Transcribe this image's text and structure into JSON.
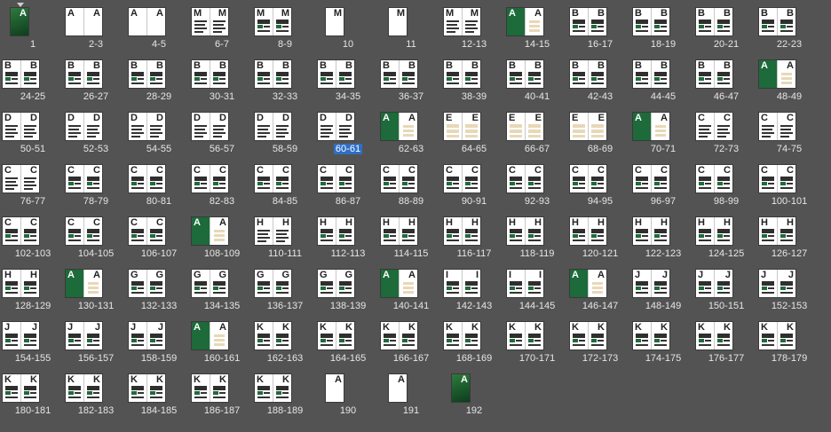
{
  "panel": {
    "title": "",
    "selected": "60-61"
  },
  "spreads": [
    {
      "label": "1",
      "l": "",
      "r": "A",
      "kind": "cover"
    },
    {
      "label": "2-3",
      "l": "A",
      "r": "A",
      "kind": "plain"
    },
    {
      "label": "4-5",
      "l": "A",
      "r": "A",
      "kind": "plain"
    },
    {
      "label": "6-7",
      "l": "M",
      "r": "M",
      "kind": "text"
    },
    {
      "label": "8-9",
      "l": "M",
      "r": "M",
      "kind": "dense"
    },
    {
      "label": "10",
      "l": "",
      "r": "M",
      "kind": "single"
    },
    {
      "label": "11",
      "l": "",
      "r": "M",
      "kind": "single"
    },
    {
      "label": "12-13",
      "l": "M",
      "r": "M",
      "kind": "text"
    },
    {
      "label": "14-15",
      "l": "A",
      "r": "A",
      "kind": "green"
    },
    {
      "label": "16-17",
      "l": "B",
      "r": "B",
      "kind": "dense"
    },
    {
      "label": "18-19",
      "l": "B",
      "r": "B",
      "kind": "dense"
    },
    {
      "label": "20-21",
      "l": "B",
      "r": "B",
      "kind": "dense"
    },
    {
      "label": "22-23",
      "l": "B",
      "r": "B",
      "kind": "dense"
    },
    {
      "label": "24-25",
      "l": "B",
      "r": "B",
      "kind": "dense"
    },
    {
      "label": "26-27",
      "l": "B",
      "r": "B",
      "kind": "dense"
    },
    {
      "label": "28-29",
      "l": "B",
      "r": "B",
      "kind": "dense"
    },
    {
      "label": "30-31",
      "l": "B",
      "r": "B",
      "kind": "dense"
    },
    {
      "label": "32-33",
      "l": "B",
      "r": "B",
      "kind": "dense"
    },
    {
      "label": "34-35",
      "l": "B",
      "r": "B",
      "kind": "dense"
    },
    {
      "label": "36-37",
      "l": "B",
      "r": "B",
      "kind": "dense"
    },
    {
      "label": "38-39",
      "l": "B",
      "r": "B",
      "kind": "dense"
    },
    {
      "label": "40-41",
      "l": "B",
      "r": "B",
      "kind": "dense"
    },
    {
      "label": "42-43",
      "l": "B",
      "r": "B",
      "kind": "dense"
    },
    {
      "label": "44-45",
      "l": "B",
      "r": "B",
      "kind": "dense"
    },
    {
      "label": "46-47",
      "l": "B",
      "r": "B",
      "kind": "dense"
    },
    {
      "label": "48-49",
      "l": "A",
      "r": "A",
      "kind": "green"
    },
    {
      "label": "50-51",
      "l": "D",
      "r": "D",
      "kind": "text"
    },
    {
      "label": "52-53",
      "l": "D",
      "r": "D",
      "kind": "text"
    },
    {
      "label": "54-55",
      "l": "D",
      "r": "D",
      "kind": "text"
    },
    {
      "label": "56-57",
      "l": "D",
      "r": "D",
      "kind": "text"
    },
    {
      "label": "58-59",
      "l": "D",
      "r": "D",
      "kind": "text"
    },
    {
      "label": "60-61",
      "l": "D",
      "r": "D",
      "kind": "text"
    },
    {
      "label": "62-63",
      "l": "A",
      "r": "A",
      "kind": "green"
    },
    {
      "label": "64-65",
      "l": "E",
      "r": "E",
      "kind": "tan"
    },
    {
      "label": "66-67",
      "l": "E",
      "r": "E",
      "kind": "tan"
    },
    {
      "label": "68-69",
      "l": "E",
      "r": "E",
      "kind": "tan"
    },
    {
      "label": "70-71",
      "l": "A",
      "r": "A",
      "kind": "green"
    },
    {
      "label": "72-73",
      "l": "C",
      "r": "C",
      "kind": "text"
    },
    {
      "label": "74-75",
      "l": "C",
      "r": "C",
      "kind": "text"
    },
    {
      "label": "76-77",
      "l": "C",
      "r": "C",
      "kind": "text"
    },
    {
      "label": "78-79",
      "l": "C",
      "r": "C",
      "kind": "dense"
    },
    {
      "label": "80-81",
      "l": "C",
      "r": "C",
      "kind": "dense"
    },
    {
      "label": "82-83",
      "l": "C",
      "r": "C",
      "kind": "dense"
    },
    {
      "label": "84-85",
      "l": "C",
      "r": "C",
      "kind": "dense"
    },
    {
      "label": "86-87",
      "l": "C",
      "r": "C",
      "kind": "dense"
    },
    {
      "label": "88-89",
      "l": "C",
      "r": "C",
      "kind": "dense"
    },
    {
      "label": "90-91",
      "l": "C",
      "r": "C",
      "kind": "dense"
    },
    {
      "label": "92-93",
      "l": "C",
      "r": "C",
      "kind": "dense"
    },
    {
      "label": "94-95",
      "l": "C",
      "r": "C",
      "kind": "dense"
    },
    {
      "label": "96-97",
      "l": "C",
      "r": "C",
      "kind": "dense"
    },
    {
      "label": "98-99",
      "l": "C",
      "r": "C",
      "kind": "dense"
    },
    {
      "label": "100-101",
      "l": "C",
      "r": "C",
      "kind": "dense"
    },
    {
      "label": "102-103",
      "l": "C",
      "r": "C",
      "kind": "dense"
    },
    {
      "label": "104-105",
      "l": "C",
      "r": "C",
      "kind": "dense"
    },
    {
      "label": "106-107",
      "l": "C",
      "r": "C",
      "kind": "dense"
    },
    {
      "label": "108-109",
      "l": "A",
      "r": "A",
      "kind": "green"
    },
    {
      "label": "110-111",
      "l": "H",
      "r": "H",
      "kind": "text"
    },
    {
      "label": "112-113",
      "l": "H",
      "r": "H",
      "kind": "dense"
    },
    {
      "label": "114-115",
      "l": "H",
      "r": "H",
      "kind": "dense"
    },
    {
      "label": "116-117",
      "l": "H",
      "r": "H",
      "kind": "dense"
    },
    {
      "label": "118-119",
      "l": "H",
      "r": "H",
      "kind": "dense"
    },
    {
      "label": "120-121",
      "l": "H",
      "r": "H",
      "kind": "dense"
    },
    {
      "label": "122-123",
      "l": "H",
      "r": "H",
      "kind": "dense"
    },
    {
      "label": "124-125",
      "l": "H",
      "r": "H",
      "kind": "dense"
    },
    {
      "label": "126-127",
      "l": "H",
      "r": "H",
      "kind": "dense"
    },
    {
      "label": "128-129",
      "l": "H",
      "r": "H",
      "kind": "dense"
    },
    {
      "label": "130-131",
      "l": "A",
      "r": "A",
      "kind": "green"
    },
    {
      "label": "132-133",
      "l": "G",
      "r": "G",
      "kind": "dense"
    },
    {
      "label": "134-135",
      "l": "G",
      "r": "G",
      "kind": "dense"
    },
    {
      "label": "136-137",
      "l": "G",
      "r": "G",
      "kind": "dense"
    },
    {
      "label": "138-139",
      "l": "G",
      "r": "G",
      "kind": "dense"
    },
    {
      "label": "140-141",
      "l": "A",
      "r": "A",
      "kind": "green"
    },
    {
      "label": "142-143",
      "l": "I",
      "r": "I",
      "kind": "dense"
    },
    {
      "label": "144-145",
      "l": "I",
      "r": "I",
      "kind": "dense"
    },
    {
      "label": "146-147",
      "l": "A",
      "r": "A",
      "kind": "green"
    },
    {
      "label": "148-149",
      "l": "J",
      "r": "J",
      "kind": "dense"
    },
    {
      "label": "150-151",
      "l": "J",
      "r": "J",
      "kind": "dense"
    },
    {
      "label": "152-153",
      "l": "J",
      "r": "J",
      "kind": "dense"
    },
    {
      "label": "154-155",
      "l": "J",
      "r": "J",
      "kind": "dense"
    },
    {
      "label": "156-157",
      "l": "J",
      "r": "J",
      "kind": "dense"
    },
    {
      "label": "158-159",
      "l": "J",
      "r": "J",
      "kind": "dense"
    },
    {
      "label": "160-161",
      "l": "A",
      "r": "A",
      "kind": "green"
    },
    {
      "label": "162-163",
      "l": "K",
      "r": "K",
      "kind": "dense"
    },
    {
      "label": "164-165",
      "l": "K",
      "r": "K",
      "kind": "dense"
    },
    {
      "label": "166-167",
      "l": "K",
      "r": "K",
      "kind": "dense"
    },
    {
      "label": "168-169",
      "l": "K",
      "r": "K",
      "kind": "dense"
    },
    {
      "label": "170-171",
      "l": "K",
      "r": "K",
      "kind": "dense"
    },
    {
      "label": "172-173",
      "l": "K",
      "r": "K",
      "kind": "dense"
    },
    {
      "label": "174-175",
      "l": "K",
      "r": "K",
      "kind": "dense"
    },
    {
      "label": "176-177",
      "l": "K",
      "r": "K",
      "kind": "dense"
    },
    {
      "label": "178-179",
      "l": "K",
      "r": "K",
      "kind": "dense"
    },
    {
      "label": "180-181",
      "l": "K",
      "r": "K",
      "kind": "dense"
    },
    {
      "label": "182-183",
      "l": "K",
      "r": "K",
      "kind": "dense"
    },
    {
      "label": "184-185",
      "l": "K",
      "r": "K",
      "kind": "dense"
    },
    {
      "label": "186-187",
      "l": "K",
      "r": "K",
      "kind": "dense"
    },
    {
      "label": "188-189",
      "l": "K",
      "r": "K",
      "kind": "dense"
    },
    {
      "label": "190",
      "l": "",
      "r": "A",
      "kind": "single"
    },
    {
      "label": "191",
      "l": "",
      "r": "A",
      "kind": "single"
    },
    {
      "label": "192",
      "l": "",
      "r": "A",
      "kind": "backcover"
    }
  ]
}
